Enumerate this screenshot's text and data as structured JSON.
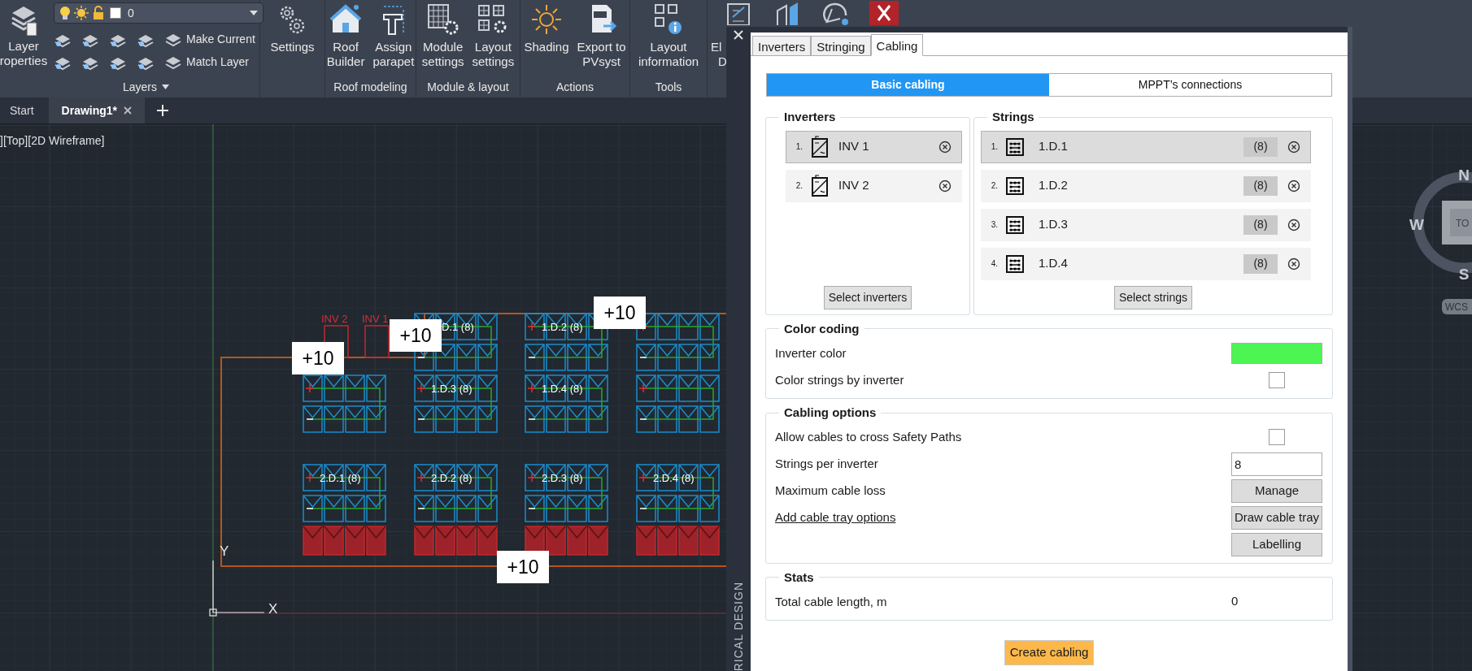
{
  "ribbon": {
    "layer_properties": "Layer\nroperties",
    "layer_dropdown": {
      "value": "0"
    },
    "layer_commands": [
      "Make Current",
      "Match Layer"
    ],
    "layers_group": "Layers",
    "groups": [
      {
        "buttons": [
          "Settings"
        ]
      },
      {
        "label": "Roof modeling",
        "buttons": [
          "Roof\nBuilder",
          "Assign\nparapet"
        ]
      },
      {
        "label": "Module & layout",
        "buttons": [
          "Module\nsettings",
          "Layout\nsettings"
        ]
      },
      {
        "label": "Actions",
        "buttons": [
          "Shading",
          "Export to\nPVsyst"
        ]
      },
      {
        "label": "Tools",
        "buttons": [
          "Layout\ninformation"
        ]
      }
    ],
    "cut_button": {
      "lines": [
        "El",
        "D"
      ]
    }
  },
  "document_tabs": [
    {
      "label": "Start",
      "selected": false
    },
    {
      "label": "Drawing1*",
      "selected": true
    }
  ],
  "drawing": {
    "view_label": "][Top][2D Wireframe]",
    "inverters": [
      "INV 2",
      "INV 1"
    ],
    "length_tags": [
      "+10",
      "+10",
      "+10",
      "+10"
    ],
    "string_labels": [
      "D.1 (8)",
      "1.D.2 (8)",
      "1.D.3 (8)",
      "1.D.4 (8)",
      "2.D.1 (8)",
      "2.D.2 (8)",
      "2.D.3 (8)",
      "2.D.4 (8)"
    ],
    "ucs_axes": [
      "Y",
      "X"
    ],
    "compass": {
      "directions": [
        "N",
        "W",
        "S"
      ],
      "view_cube": "TO",
      "ucs": "WCS"
    }
  },
  "panel": {
    "side_title": "RICAL DESIGN",
    "tabs": [
      {
        "label": "Inverters",
        "selected": false
      },
      {
        "label": "Stringing",
        "selected": false
      },
      {
        "label": "Cabling",
        "selected": true
      }
    ],
    "modes": [
      {
        "label": "Basic cabling",
        "selected": true
      },
      {
        "label": "MPPT’s connections",
        "selected": false
      }
    ],
    "inverters": {
      "title": "Inverters",
      "items": [
        {
          "number": "1.",
          "name": "INV 1",
          "selected": true
        },
        {
          "number": "2.",
          "name": "INV 2",
          "selected": false
        }
      ],
      "button": "Select inverters"
    },
    "strings": {
      "title": "Strings",
      "items": [
        {
          "number": "1.",
          "name": "1.D.1",
          "count": "(8)",
          "selected": true
        },
        {
          "number": "2.",
          "name": "1.D.2",
          "count": "(8)",
          "selected": false
        },
        {
          "number": "3.",
          "name": "1.D.3",
          "count": "(8)",
          "selected": false
        },
        {
          "number": "4.",
          "name": "1.D.4",
          "count": "(8)",
          "selected": false
        }
      ],
      "button": "Select strings"
    },
    "sections": [
      {
        "title": "Color coding",
        "rows": [
          {
            "kind": "color",
            "label": "Inverter color",
            "color": "#4cf552"
          },
          {
            "kind": "checkbox",
            "label": "Color strings by inverter",
            "checked": false
          }
        ]
      },
      {
        "title": "Cabling options",
        "rows": [
          {
            "kind": "checkbox",
            "label": "Allow cables to cross Safety Paths",
            "checked": false
          },
          {
            "kind": "input",
            "label": "Strings per inverter",
            "value": "8"
          },
          {
            "kind": "button",
            "label": "Maximum cable loss",
            "button": "Manage"
          },
          {
            "kind": "link",
            "label": "Add cable tray options",
            "button": "Draw cable tray"
          },
          {
            "kind": "button",
            "button": "Labelling"
          }
        ]
      },
      {
        "title": "Stats",
        "rows": [
          {
            "kind": "value",
            "label": "Total cable length, m",
            "value": "0"
          }
        ]
      }
    ],
    "create_button": "Create cabling"
  }
}
